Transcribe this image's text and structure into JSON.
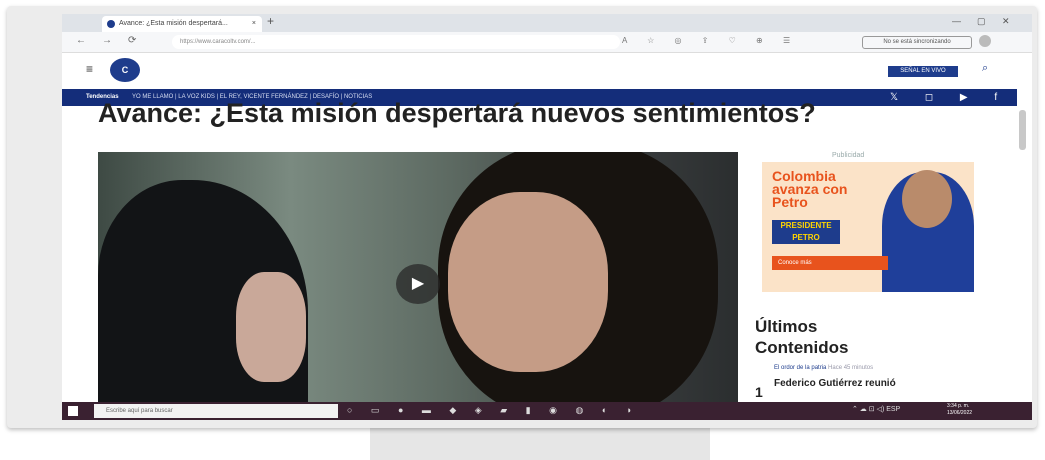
{
  "browser": {
    "tab_title": "Avance: ¿Esta misión despertará...",
    "tab_close": "×",
    "new_tab": "+",
    "url": "https://www.caracoltv.com/...",
    "sync_button": "No se está sincronizando",
    "nav_back": "←",
    "nav_forward": "→",
    "nav_reload": "⟳",
    "toolbar_icons": "A ☆ ◎ ⇪ ♡ ⊕ ☰"
  },
  "site": {
    "menu_icon": "≡",
    "logo": "C",
    "header_button": "SEÑAL EN VIVO",
    "search_icon": "⌕",
    "trending_label": "Tendencias",
    "trending_items": "YO ME LLAMO  |  LA VOZ KIDS  |  EL REY, VICENTE FERNÁNDEZ  |  DESAFÍO  |  NOTICIAS",
    "social_icons": "𝕏 ◻ ▶ f"
  },
  "article": {
    "headline": "Avance: ¿Esta misión despertará nuevos sentimientos?",
    "play_icon": "▶"
  },
  "sidebar": {
    "publicidad": "Publicidad",
    "ad_line1": "Colombia",
    "ad_line2": "avanza con",
    "ad_line3": "Petro",
    "ad_badge": "PRESIDENTE PETRO",
    "ad_cta": "Conoce más",
    "ultimos_title": "Últimos Contenidos",
    "ultimos_category": "El ordor de la patria",
    "ultimos_meta": "Hace 45 minutos",
    "ultimos_number": "1",
    "ultimos_item": "Federico Gutiérrez reunió"
  },
  "taskbar": {
    "search_placeholder": "Escribe aquí para buscar",
    "apps": "○ ▭ ● ▬ ◆ ◈ ▰ ▮ ◉ ◍ ◐ ◑",
    "tray": "⌃ ☁ ⊡ ◁) ESP",
    "time": "3:34 p. m.",
    "date": "13/06/2022"
  },
  "colors": {
    "brand": "#1e3c8c",
    "trend_bar": "#142d7a",
    "ad_orange": "#e8531d",
    "taskbar": "#3a2131"
  }
}
